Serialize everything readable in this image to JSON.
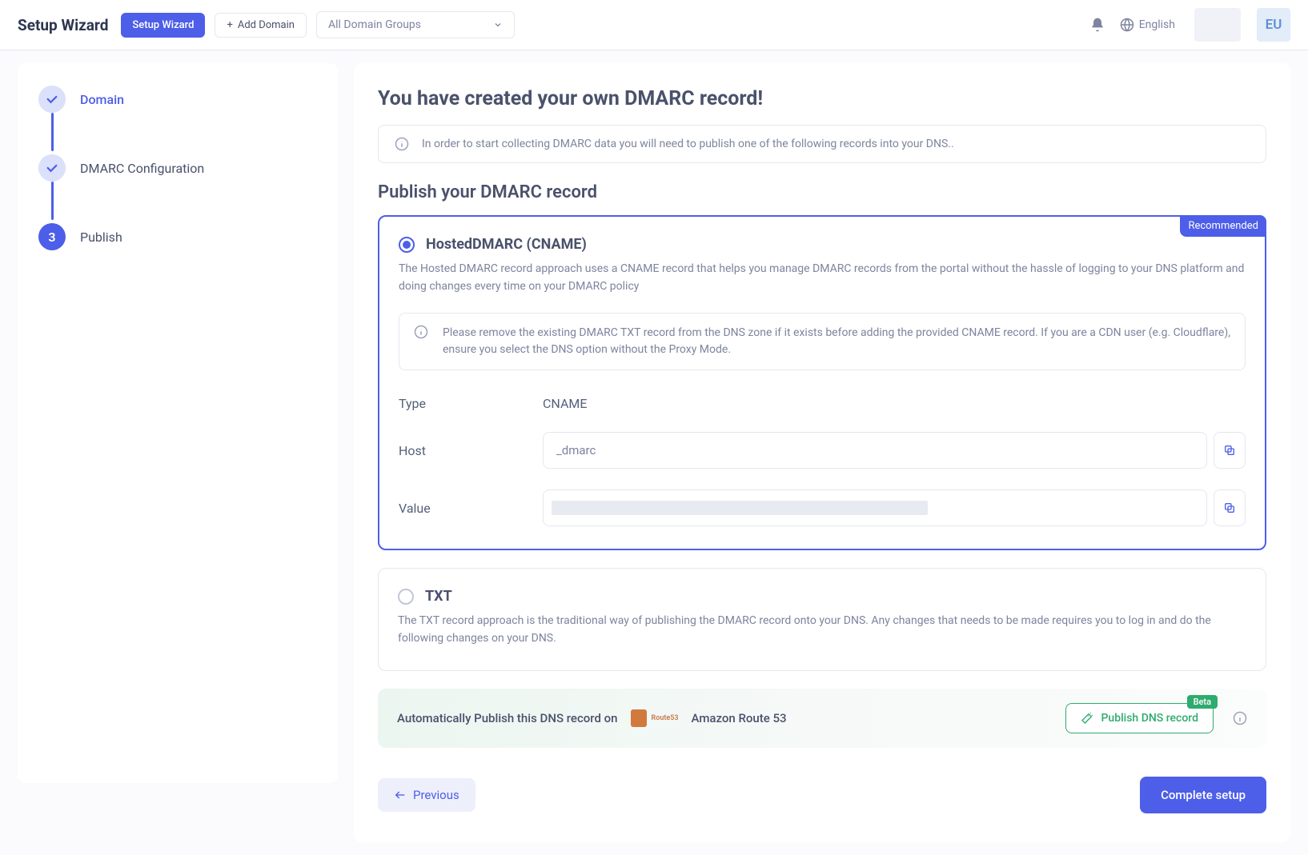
{
  "header": {
    "title": "Setup Wizard",
    "primary_btn": "Setup Wizard",
    "add_btn": "Add Domain",
    "group_select": "All Domain Groups",
    "language": "English",
    "region": "EU"
  },
  "steps": [
    {
      "label": "Domain",
      "state": "done"
    },
    {
      "label": "DMARC Configuration",
      "state": "done"
    },
    {
      "label": "Publish",
      "state": "active",
      "num": "3"
    }
  ],
  "main": {
    "heading": "You have created your own DMARC record!",
    "info": "In order to start collecting DMARC data you will need to publish one of the following records into your DNS..",
    "subheading": "Publish your DMARC record"
  },
  "hosted": {
    "title": "HostedDMARC (CNAME)",
    "recommended": "Recommended",
    "desc": "The Hosted DMARC record approach uses a CNAME record that helps you manage DMARC records from the portal without the hassle of logging to your DNS platform and doing changes every time on your DMARC policy",
    "warn": "Please remove the existing DMARC TXT record from the DNS zone if it exists before adding the provided CNAME record. If you are a CDN user (e.g. Cloudflare), ensure you select the DNS option without the Proxy Mode.",
    "type_label": "Type",
    "type_value": "CNAME",
    "host_label": "Host",
    "host_value": "_dmarc",
    "value_label": "Value"
  },
  "txt": {
    "title": "TXT",
    "desc": "The TXT record approach is the traditional way of publishing the DMARC record onto your DNS. Any changes that needs to be made requires you to log in and do the following changes on your DNS."
  },
  "auto": {
    "text_pre": "Automatically Publish this DNS record on",
    "provider_logo_text": "Route53",
    "provider": "Amazon Route 53",
    "publish_btn": "Publish DNS record",
    "beta": "Beta"
  },
  "footer": {
    "prev": "Previous",
    "complete": "Complete setup"
  }
}
